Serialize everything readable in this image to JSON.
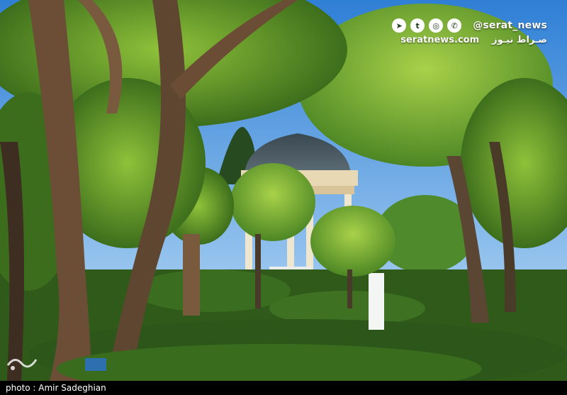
{
  "watermark": {
    "handle": "@serat_news",
    "site": "seratnews.com",
    "site_fa": "صـراط نیـوز",
    "icons": [
      "telegram-icon",
      "twitter-icon",
      "instagram-icon",
      "whatsapp-icon"
    ]
  },
  "caption": {
    "text": "photo : Amir Sadeghian"
  },
  "colors": {
    "sky": "#3d8fe0",
    "foliage": "#3f7a22",
    "caption_bg": "#000000"
  }
}
